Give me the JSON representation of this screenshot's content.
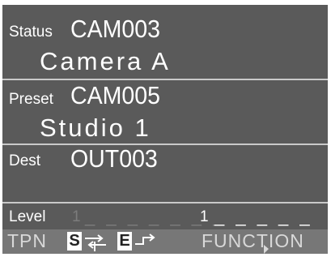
{
  "status": {
    "label": "Status",
    "camera_id": "CAM003",
    "camera_name": "Camera A"
  },
  "preset": {
    "label": "Preset",
    "camera_id": "CAM005",
    "camera_name": "Studio 1"
  },
  "dest": {
    "label": "Dest",
    "output_id": "OUT003"
  },
  "level": {
    "label": "Level",
    "left_value": "1",
    "left_dashes": "_ _ _ _ _ _ _",
    "right_value": "1",
    "right_dashes": "_ _ _ _ _ _ _"
  },
  "footer": {
    "tpn_label": "TPN",
    "s_key": "S",
    "e_key": "E",
    "function_label": "FUNCTION"
  },
  "colors": {
    "screen_bg": "#5a5a5a",
    "footer_bg": "#777777",
    "text": "#ffffff"
  }
}
